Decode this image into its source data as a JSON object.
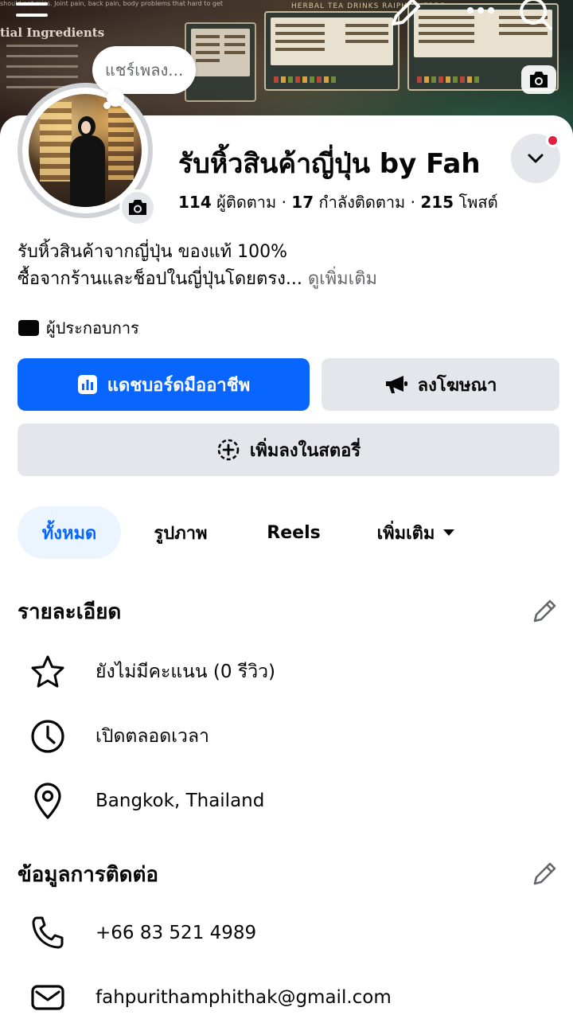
{
  "cover": {
    "brand_text": "HERBAL TEA DRINKS RAIPHO HERBS",
    "ingredients_text": "tial Ingredients",
    "faint_text": "should not miss. Joint pain, back pain, body problems that hard to get"
  },
  "status_bubble": {
    "text": "แชร์เพลง..."
  },
  "profile": {
    "name": "รับหิ้วสินค้าญี่ปุ่น by Fah",
    "followers_count": "114",
    "followers_label": "ผู้ติดตาม",
    "following_count": "17",
    "following_label": "กำลังติดตาม",
    "posts_count": "215",
    "posts_label": "โพสต์",
    "separator": " · "
  },
  "bio": {
    "line1": "รับหิ้วสินค้าจากญี่ปุ่น ของแท้ 100%",
    "line2": "ซื้อจากร้านและช็อปในญี่ปุ่นโดยตรง...",
    "see_more": "ดูเพิ่มเติม"
  },
  "category": {
    "label": "ผู้ประกอบการ",
    "icon": "video-clapper-icon"
  },
  "buttons": {
    "dashboard": "แดชบอร์ดมืออาชีพ",
    "advertise": "ลงโฆษณา",
    "add_story": "เพิ่มลงในสตอรี่"
  },
  "tabs": [
    {
      "label": "ทั้งหมด",
      "active": true
    },
    {
      "label": "รูปภาพ",
      "active": false
    },
    {
      "label": "Reels",
      "active": false
    },
    {
      "label": "เพิ่มเติม",
      "active": false
    }
  ],
  "details": {
    "title": "รายละเอียด",
    "rating": "ยังไม่มีคะแนน (0 รีวิว)",
    "hours": "เปิดตลอดเวลา",
    "location": "Bangkok, Thailand"
  },
  "contact": {
    "title": "ข้อมูลการติดต่อ",
    "phone": "+66 83 521 4989",
    "email": "fahpurithamphithak@gmail.com"
  },
  "colors": {
    "primary": "#0866ff",
    "button_gray": "#e4e6eb",
    "tab_active_bg": "#ebf5ff",
    "notification": "#e41e3f",
    "text": "#050505",
    "muted": "#65676b"
  }
}
